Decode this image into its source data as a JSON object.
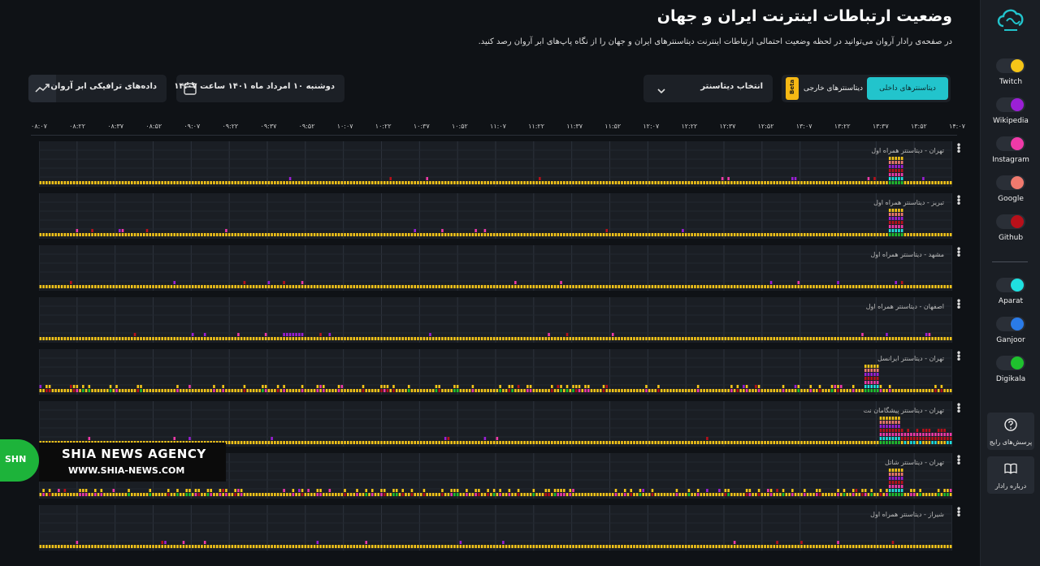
{
  "header": {
    "title": "وضعیت ارتباطات اینترنت ایران و جهان",
    "subtitle": "در صفحه‌ی رادار آروان می‌توانید در لحظه وضعیت احتمالی ارتباطات اینترنت دیتاسنترهای ایران و جهان را از نگاه پاپ‌های ابر آروان رصد کنید."
  },
  "controls": {
    "traffic_label": "داده‌های ترافیکی ابر آروان",
    "date_label": "دوشنبه ۱۰ امرداد ماه ۱۴۰۱ ساعت ۱۴:۰۷",
    "select_label": "انتخاب دیتاسنتر",
    "tab_domestic": "دیتاسنترهای داخلی",
    "tab_foreign": "دیتاسنترهای خارجی",
    "beta": "Beta"
  },
  "timeline": [
    "۰۸:۰۷",
    "۰۸:۲۲",
    "۰۸:۳۷",
    "۰۸:۵۲",
    "۰۹:۰۷",
    "۰۹:۲۲",
    "۰۹:۳۷",
    "۰۹:۵۲",
    "۱۰:۰۷",
    "۱۰:۲۲",
    "۱۰:۳۷",
    "۱۰:۵۲",
    "۱۱:۰۷",
    "۱۱:۲۲",
    "۱۱:۳۷",
    "۱۱:۵۲",
    "۱۲:۰۷",
    "۱۲:۲۲",
    "۱۲:۳۷",
    "۱۲:۵۲",
    "۱۳:۰۷",
    "۱۳:۲۲",
    "۱۳:۳۷",
    "۱۳:۵۲",
    "۱۴:۰۷"
  ],
  "panels": [
    {
      "label": "تهران - دیتاسنتر همراه اول"
    },
    {
      "label": "تبریز - دیتاسنتر همراه اول"
    },
    {
      "label": "مشهد - دیتاسنتر همراه اول"
    },
    {
      "label": "اصفهان - دیتاسنتر همراه اول"
    },
    {
      "label": "تهران - دیتاسنتر ایرانسل"
    },
    {
      "label": "تهران - دیتاسنتر پیشگامان نت"
    },
    {
      "label": "تهران - دیتاسنتر شاتل"
    },
    {
      "label": "شیراز - دیتاسنتر همراه اول"
    }
  ],
  "services": [
    {
      "name": "Twitch",
      "color": "#f5c518"
    },
    {
      "name": "Wikipedia",
      "color": "#9b1fd6"
    },
    {
      "name": "Instagram",
      "color": "#ef3aa8"
    },
    {
      "name": "Google",
      "color": "#f07a6e"
    },
    {
      "name": "Github",
      "color": "#b8101a"
    },
    {
      "name": "Aparat",
      "color": "#1fe0e0"
    },
    {
      "name": "Ganjoor",
      "color": "#2a7be8"
    },
    {
      "name": "Digikala",
      "color": "#1fc12e"
    }
  ],
  "sidebar": {
    "faq_label": "پرسش‌های رایج",
    "about_label": "درباره رادار"
  },
  "watermark": {
    "badge": "SHN",
    "name": "SHIA NEWS AGENCY",
    "url": "WWW.SHIA-NEWS.COM"
  }
}
